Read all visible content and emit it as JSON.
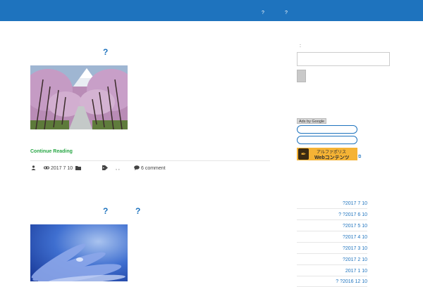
{
  "header": {
    "nav": [
      "?",
      "?"
    ]
  },
  "posts": [
    {
      "title": "?",
      "continue_label": "Continue Reading",
      "date": "2017 7 10",
      "tags_text": ", ,",
      "comments": "6 comment"
    },
    {
      "title_parts": [
        "?",
        "?"
      ]
    }
  ],
  "sidebar": {
    "search_label": ":",
    "ads_label": "Ads by Google",
    "banner": {
      "line1": "アルファポリス",
      "line2": "Webコンテンツ"
    },
    "archives": [
      "?2017 7 10",
      "? ?2017 6 10",
      "?2017 5 10",
      "?2017 4 10",
      "?2017 3 10",
      "?2017 2 10",
      "2017 1 10",
      "? ?2016 12 10"
    ]
  }
}
